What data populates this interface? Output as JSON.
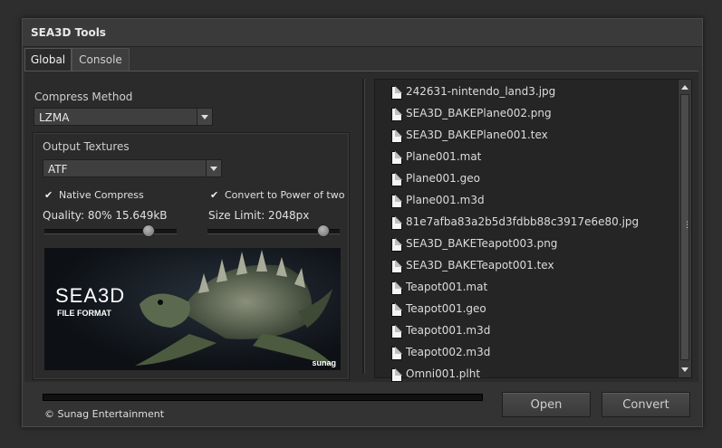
{
  "window": {
    "title": "SEA3D Tools"
  },
  "tabs": [
    {
      "label": "Global",
      "active": true
    },
    {
      "label": "Console",
      "active": false
    }
  ],
  "global": {
    "compress_method": {
      "label": "Compress Method",
      "selected": "LZMA"
    },
    "output_textures": {
      "label": "Output Textures",
      "format_selected": "ATF",
      "native_compress": {
        "label": "Native Compress",
        "checked": true
      },
      "power_of_two": {
        "label": "Convert to Power of two",
        "checked": true
      },
      "quality": {
        "label": "Quality: 80% 15.649kB",
        "value_percent": 80
      },
      "size_limit": {
        "label": "Size Limit: 2048px",
        "value": 2048
      }
    },
    "banner": {
      "title": "SEA3D",
      "subtitle": "FILE FORMAT",
      "corner_text": "sunag"
    }
  },
  "files": [
    "242631-nintendo_land3.jpg",
    "SEA3D_BAKEPlane002.png",
    "SEA3D_BAKEPlane001.tex",
    "Plane001.mat",
    "Plane001.geo",
    "Plane001.m3d",
    "81e7afba83a2b5d3fdbb88c3917e6e80.jpg",
    "SEA3D_BAKETeapot003.png",
    "SEA3D_BAKETeapot001.tex",
    "Teapot001.mat",
    "Teapot001.geo",
    "Teapot001.m3d",
    "Teapot002.m3d",
    "Omni001.plht"
  ],
  "footer": {
    "progress_percent": 0,
    "copyright": "© Sunag Entertainment",
    "open_label": "Open",
    "convert_label": "Convert"
  },
  "colors": {
    "background": "#2e2e2e",
    "panel": "#2b2b2b",
    "accent_progress": "#3d6fa8"
  }
}
